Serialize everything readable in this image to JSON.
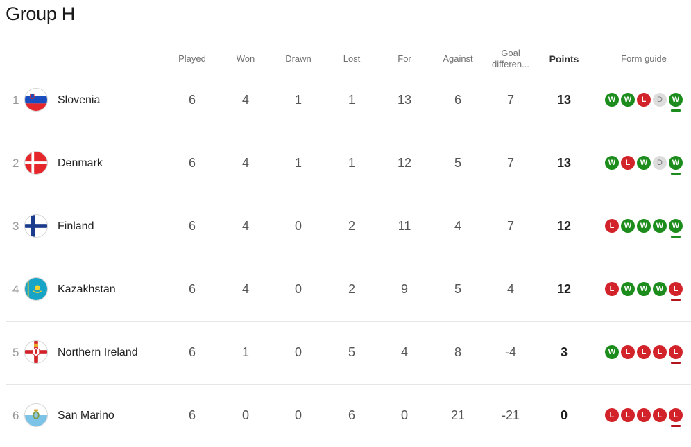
{
  "title": "Group H",
  "columns": {
    "played": "Played",
    "won": "Won",
    "drawn": "Drawn",
    "lost": "Lost",
    "for": "For",
    "against": "Against",
    "goal_difference": "Goal differen...",
    "points": "Points",
    "form_guide": "Form guide"
  },
  "teams": [
    {
      "pos": "1",
      "name": "Slovenia",
      "flag": "slovenia-flag",
      "played": "6",
      "won": "4",
      "drawn": "1",
      "lost": "1",
      "for": "13",
      "against": "6",
      "gd": "7",
      "points": "13",
      "form": [
        "W",
        "W",
        "L",
        "D",
        "W"
      ]
    },
    {
      "pos": "2",
      "name": "Denmark",
      "flag": "denmark-flag",
      "played": "6",
      "won": "4",
      "drawn": "1",
      "lost": "1",
      "for": "12",
      "against": "5",
      "gd": "7",
      "points": "13",
      "form": [
        "W",
        "L",
        "W",
        "D",
        "W"
      ]
    },
    {
      "pos": "3",
      "name": "Finland",
      "flag": "finland-flag",
      "played": "6",
      "won": "4",
      "drawn": "0",
      "lost": "2",
      "for": "11",
      "against": "4",
      "gd": "7",
      "points": "12",
      "form": [
        "L",
        "W",
        "W",
        "W",
        "W"
      ]
    },
    {
      "pos": "4",
      "name": "Kazakhstan",
      "flag": "kazakhstan-flag",
      "played": "6",
      "won": "4",
      "drawn": "0",
      "lost": "2",
      "for": "9",
      "against": "5",
      "gd": "4",
      "points": "12",
      "form": [
        "L",
        "W",
        "W",
        "W",
        "L"
      ]
    },
    {
      "pos": "5",
      "name": "Northern Ireland",
      "flag": "northern-ireland-flag",
      "played": "6",
      "won": "1",
      "drawn": "0",
      "lost": "5",
      "for": "4",
      "against": "8",
      "gd": "-4",
      "points": "3",
      "form": [
        "W",
        "L",
        "L",
        "L",
        "L"
      ]
    },
    {
      "pos": "6",
      "name": "San Marino",
      "flag": "san-marino-flag",
      "played": "6",
      "won": "0",
      "drawn": "0",
      "lost": "6",
      "for": "0",
      "against": "21",
      "gd": "-21",
      "points": "0",
      "form": [
        "L",
        "L",
        "L",
        "L",
        "L"
      ]
    }
  ],
  "colors": {
    "win": "#1c8c1c",
    "loss": "#d2232a",
    "draw": "#dddddd"
  }
}
